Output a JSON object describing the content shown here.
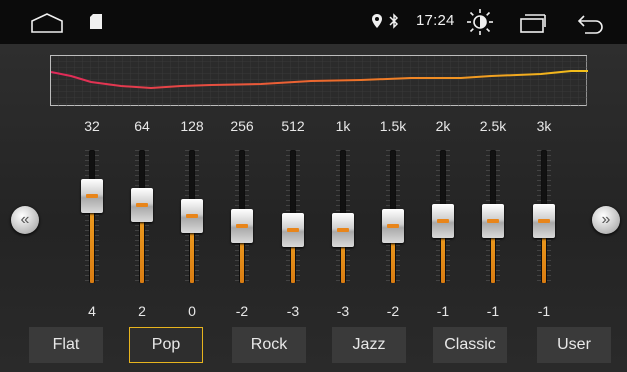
{
  "status_bar": {
    "time": "17:24",
    "icons": [
      "home-icon",
      "sd-card-icon",
      "location-icon",
      "bluetooth-icon",
      "brightness-icon",
      "recent-apps-icon",
      "back-icon"
    ]
  },
  "equalizer": {
    "nav_prev_glyph": "«",
    "nav_next_glyph": "»",
    "bands": [
      {
        "freq": "32",
        "gain": "4"
      },
      {
        "freq": "64",
        "gain": "2"
      },
      {
        "freq": "128",
        "gain": "0"
      },
      {
        "freq": "256",
        "gain": "-2"
      },
      {
        "freq": "512",
        "gain": "-3"
      },
      {
        "freq": "1k",
        "gain": "-3"
      },
      {
        "freq": "1.5k",
        "gain": "-2"
      },
      {
        "freq": "2k",
        "gain": "-1"
      },
      {
        "freq": "2.5k",
        "gain": "-1"
      },
      {
        "freq": "3k",
        "gain": "-1"
      }
    ]
  },
  "presets": [
    {
      "label": "Flat",
      "active": false
    },
    {
      "label": "Pop",
      "active": true
    },
    {
      "label": "Rock",
      "active": false
    },
    {
      "label": "Jazz",
      "active": false
    },
    {
      "label": "Classic",
      "active": false
    },
    {
      "label": "User",
      "active": false
    }
  ],
  "colors": {
    "accent": "#e7b41e",
    "slider_fill": "#e8851a",
    "curve_start": "#e0285a",
    "curve_end": "#f4c21a"
  }
}
